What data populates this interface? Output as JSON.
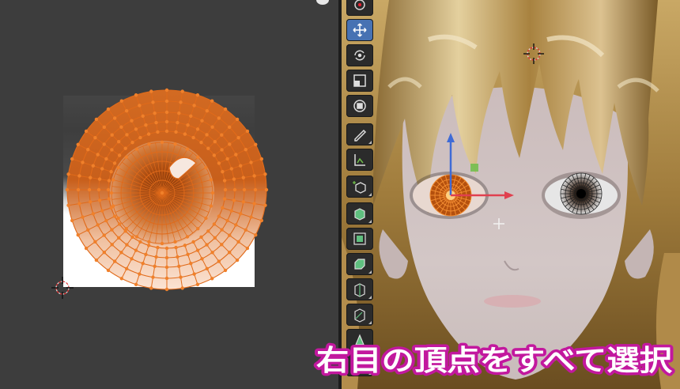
{
  "caption": {
    "text": "右目の頂点をすべて選択",
    "fill": "#ffffff",
    "outline": "#c2189e"
  },
  "colors": {
    "uv_editor_bg": "#3d3d3d",
    "toolbar_bg": "#2b2b2b",
    "active_tool": "#4772b3",
    "selected_vertex": "#f0802a",
    "wire": "#e06a1a",
    "hair": "#b69354",
    "skin": "#cfc2c2"
  },
  "toolbar": {
    "tools": [
      {
        "name": "select-tool",
        "icon": "select-box-icon",
        "active": false
      },
      {
        "name": "move-tool",
        "icon": "move-arrows-icon",
        "active": true
      },
      {
        "name": "rotate-tool",
        "icon": "rotate-icon",
        "active": false
      },
      {
        "name": "scale-tool",
        "icon": "scale-icon",
        "active": false
      },
      {
        "name": "transform-tool",
        "icon": "transform-icon",
        "active": false
      },
      {
        "name": "annotate-tool",
        "icon": "annotate-pencil-icon",
        "active": false
      },
      {
        "name": "measure-tool",
        "icon": "measure-ruler-icon",
        "active": false
      },
      {
        "name": "add-cube-tool",
        "icon": "add-cube-icon",
        "active": false
      },
      {
        "name": "extrude-tool",
        "icon": "extrude-region-icon",
        "active": false
      },
      {
        "name": "inset-tool",
        "icon": "inset-faces-icon",
        "active": false
      },
      {
        "name": "bevel-tool",
        "icon": "bevel-icon",
        "active": false
      },
      {
        "name": "loop-cut-tool",
        "icon": "loop-cut-icon",
        "active": false
      },
      {
        "name": "knife-tool",
        "icon": "knife-icon",
        "active": false
      },
      {
        "name": "poly-build-tool",
        "icon": "poly-build-icon",
        "active": false
      },
      {
        "name": "spin-tool",
        "icon": "spin-icon",
        "active": false
      }
    ]
  }
}
